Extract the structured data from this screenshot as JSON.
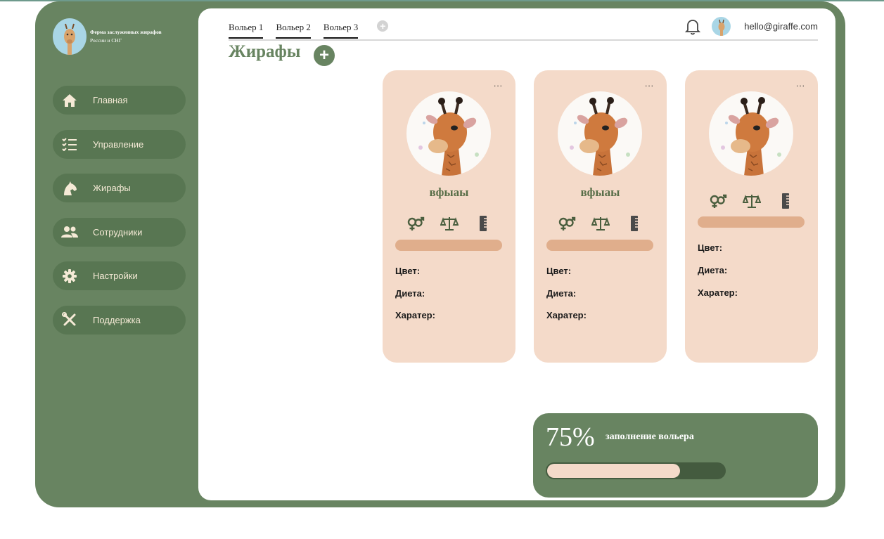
{
  "brand": {
    "title": "Ферма заслуженных жирафов",
    "subtitle": "России и СНГ"
  },
  "sidebar": {
    "items": [
      {
        "label": "Главная",
        "icon": "home-icon"
      },
      {
        "label": "Управление",
        "icon": "checklist-icon"
      },
      {
        "label": "Жирафы",
        "icon": "horse-head-icon"
      },
      {
        "label": "Сотрудники",
        "icon": "users-icon"
      },
      {
        "label": "Настройки",
        "icon": "gear-icon"
      },
      {
        "label": "Поддержка",
        "icon": "tools-icon"
      }
    ]
  },
  "tabs": [
    {
      "label": "Вольер 1"
    },
    {
      "label": "Вольер 2"
    },
    {
      "label": "Вольер 3"
    }
  ],
  "tab_add_label": "+",
  "header": {
    "email": "hello@giraffe.com"
  },
  "page": {
    "title": "Жирафы",
    "add_label": "+"
  },
  "cards": [
    {
      "menu": "...",
      "name": "вфыаы",
      "color_label": "Цвет:",
      "diet_label": "Диета:",
      "character_label": "Харатер:"
    },
    {
      "menu": "...",
      "name": "вфыаы",
      "color_label": "Цвет:",
      "diet_label": "Диета:",
      "character_label": "Харатер:"
    },
    {
      "menu": "...",
      "name": "",
      "color_label": "Цвет:",
      "diet_label": "Диета:",
      "character_label": "Харатер:"
    }
  ],
  "fill": {
    "percent_text": "75%",
    "label": "заполнение вольера",
    "value": 0.75
  },
  "colors": {
    "frame": "#688461",
    "nav_item": "#587652",
    "card_bg": "#f4dac9",
    "card_bar": "#e0ae8c",
    "name_text": "#586e48"
  }
}
